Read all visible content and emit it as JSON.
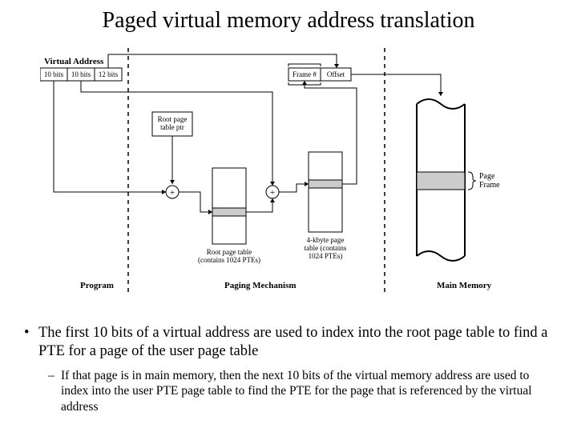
{
  "title": "Paged virtual memory address translation",
  "diagram": {
    "virtual_address": {
      "label": "Virtual Address",
      "fields": [
        "10 bits",
        "10 bits",
        "12 bits"
      ]
    },
    "physical_address": {
      "fields": [
        "Frame #",
        "Offset"
      ]
    },
    "root_page_table_ptr": "Root page\ntable ptr",
    "root_page_table_caption": "Root page table\n(contains 1024 PTEs)",
    "user_page_table_caption": "4-kbyte page\ntable (contains\n1024 PTEs)",
    "page_frame_label": "Page\nFrame",
    "section_program": "Program",
    "section_paging": "Paging Mechanism",
    "section_memory": "Main Memory",
    "plus": "+"
  },
  "bullets": {
    "main": "The first 10 bits of a virtual address are used to index into the root page table  to find a PTE for a page of the user page table",
    "sub": "If that page is in main memory, then the next 10 bits of the virtual memory address are used to index into the user PTE page table to find the PTE for the page that is referenced by the virtual address"
  }
}
